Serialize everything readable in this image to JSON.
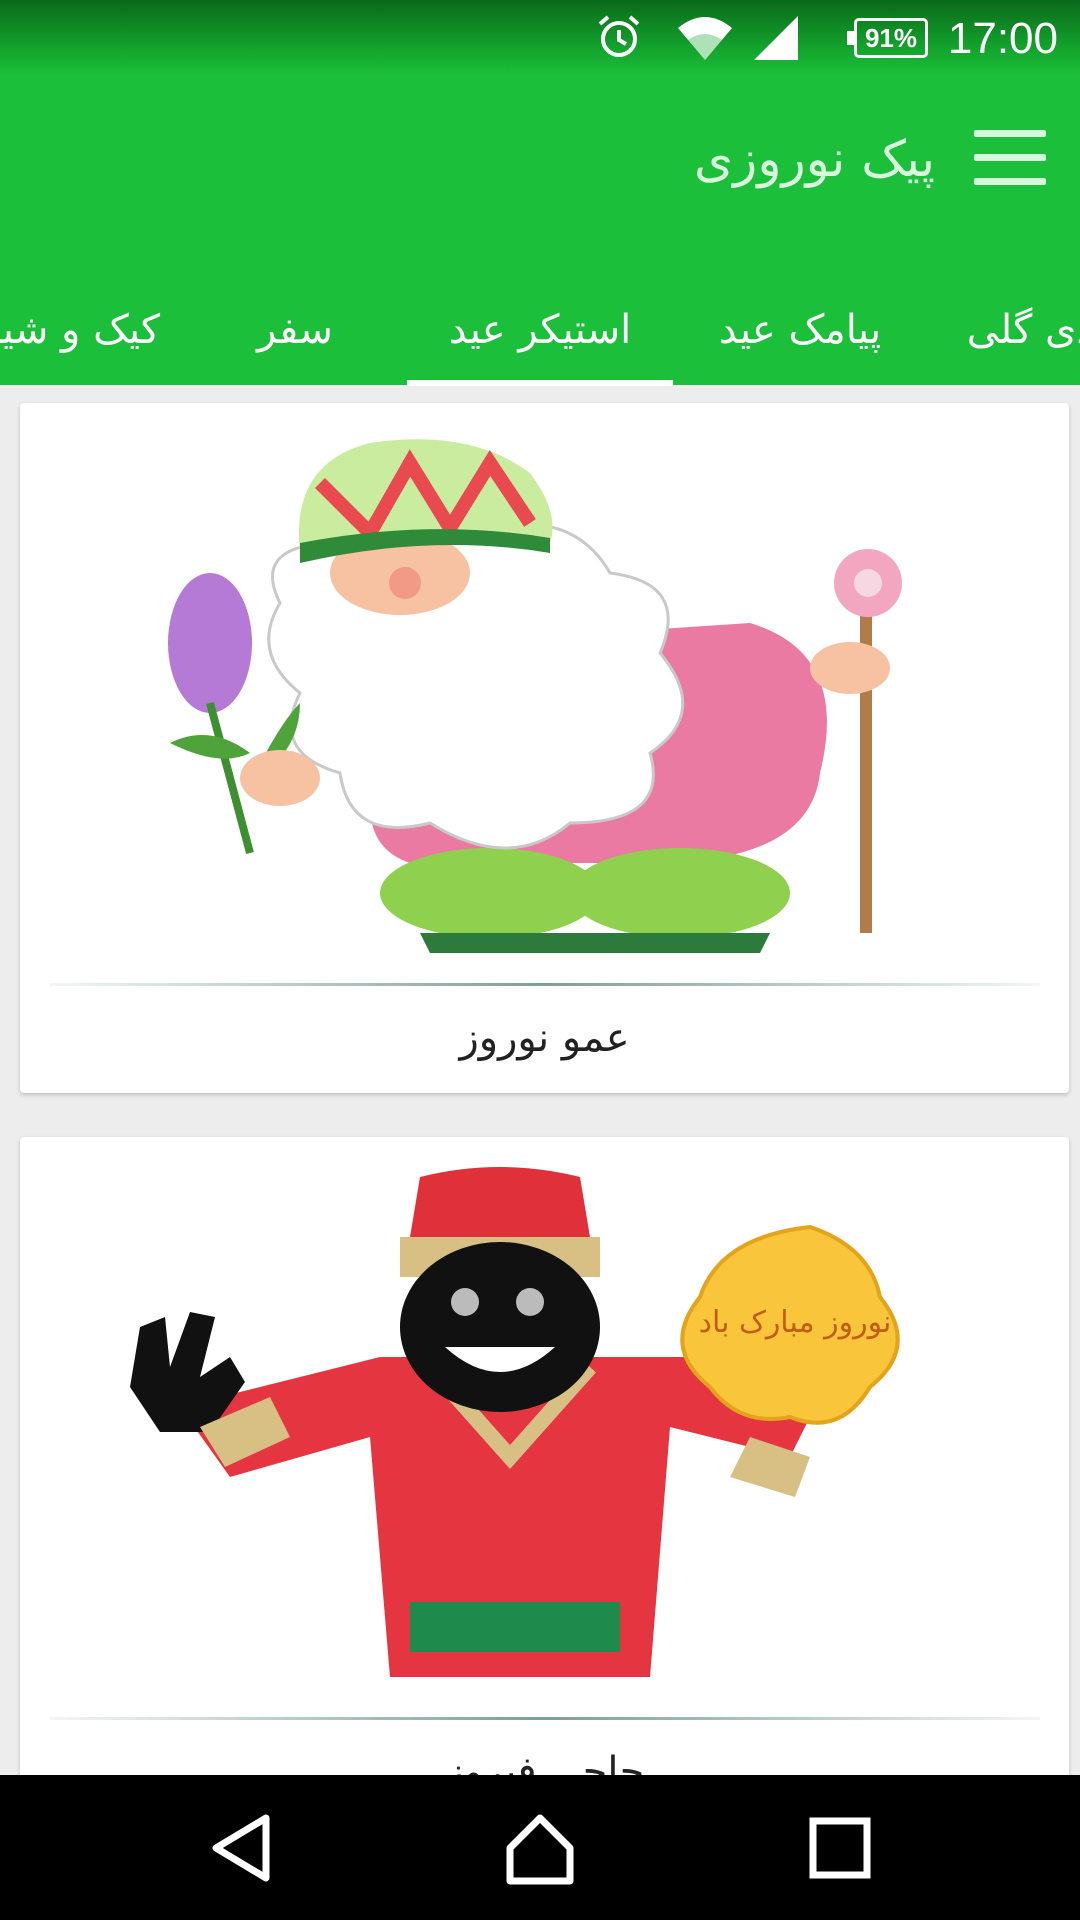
{
  "status_bar": {
    "time": "17:00",
    "battery": "91%",
    "icons": [
      "alarm-icon",
      "wifi-icon",
      "signal-icon",
      "battery-icon"
    ]
  },
  "app_bar": {
    "title": "پیک نوروزی",
    "menu_icon": "hamburger-menu-icon"
  },
  "tabs": [
    {
      "label": "کیک و شیرینی"
    },
    {
      "label": "سفر"
    },
    {
      "label": "استیکر عید"
    },
    {
      "label": "پیامک عید"
    },
    {
      "label": "عیدی گلی"
    }
  ],
  "active_tab_index": 2,
  "cards": [
    {
      "caption": "عمو نوروز",
      "image": "amoo-nowruz-illustration",
      "sign_text": ""
    },
    {
      "caption": "حاجی فیروز",
      "image": "haji-firuz-illustration",
      "sign_text": "نوروز مبارک باد"
    }
  ],
  "nav_bar": {
    "buttons": [
      "back-icon",
      "home-icon",
      "recents-icon"
    ]
  },
  "colors": {
    "primary": "#1cbf3a",
    "status_bar": "#0a6a1a",
    "title_text": "#d9f6df",
    "nav_bar": "#000000"
  }
}
